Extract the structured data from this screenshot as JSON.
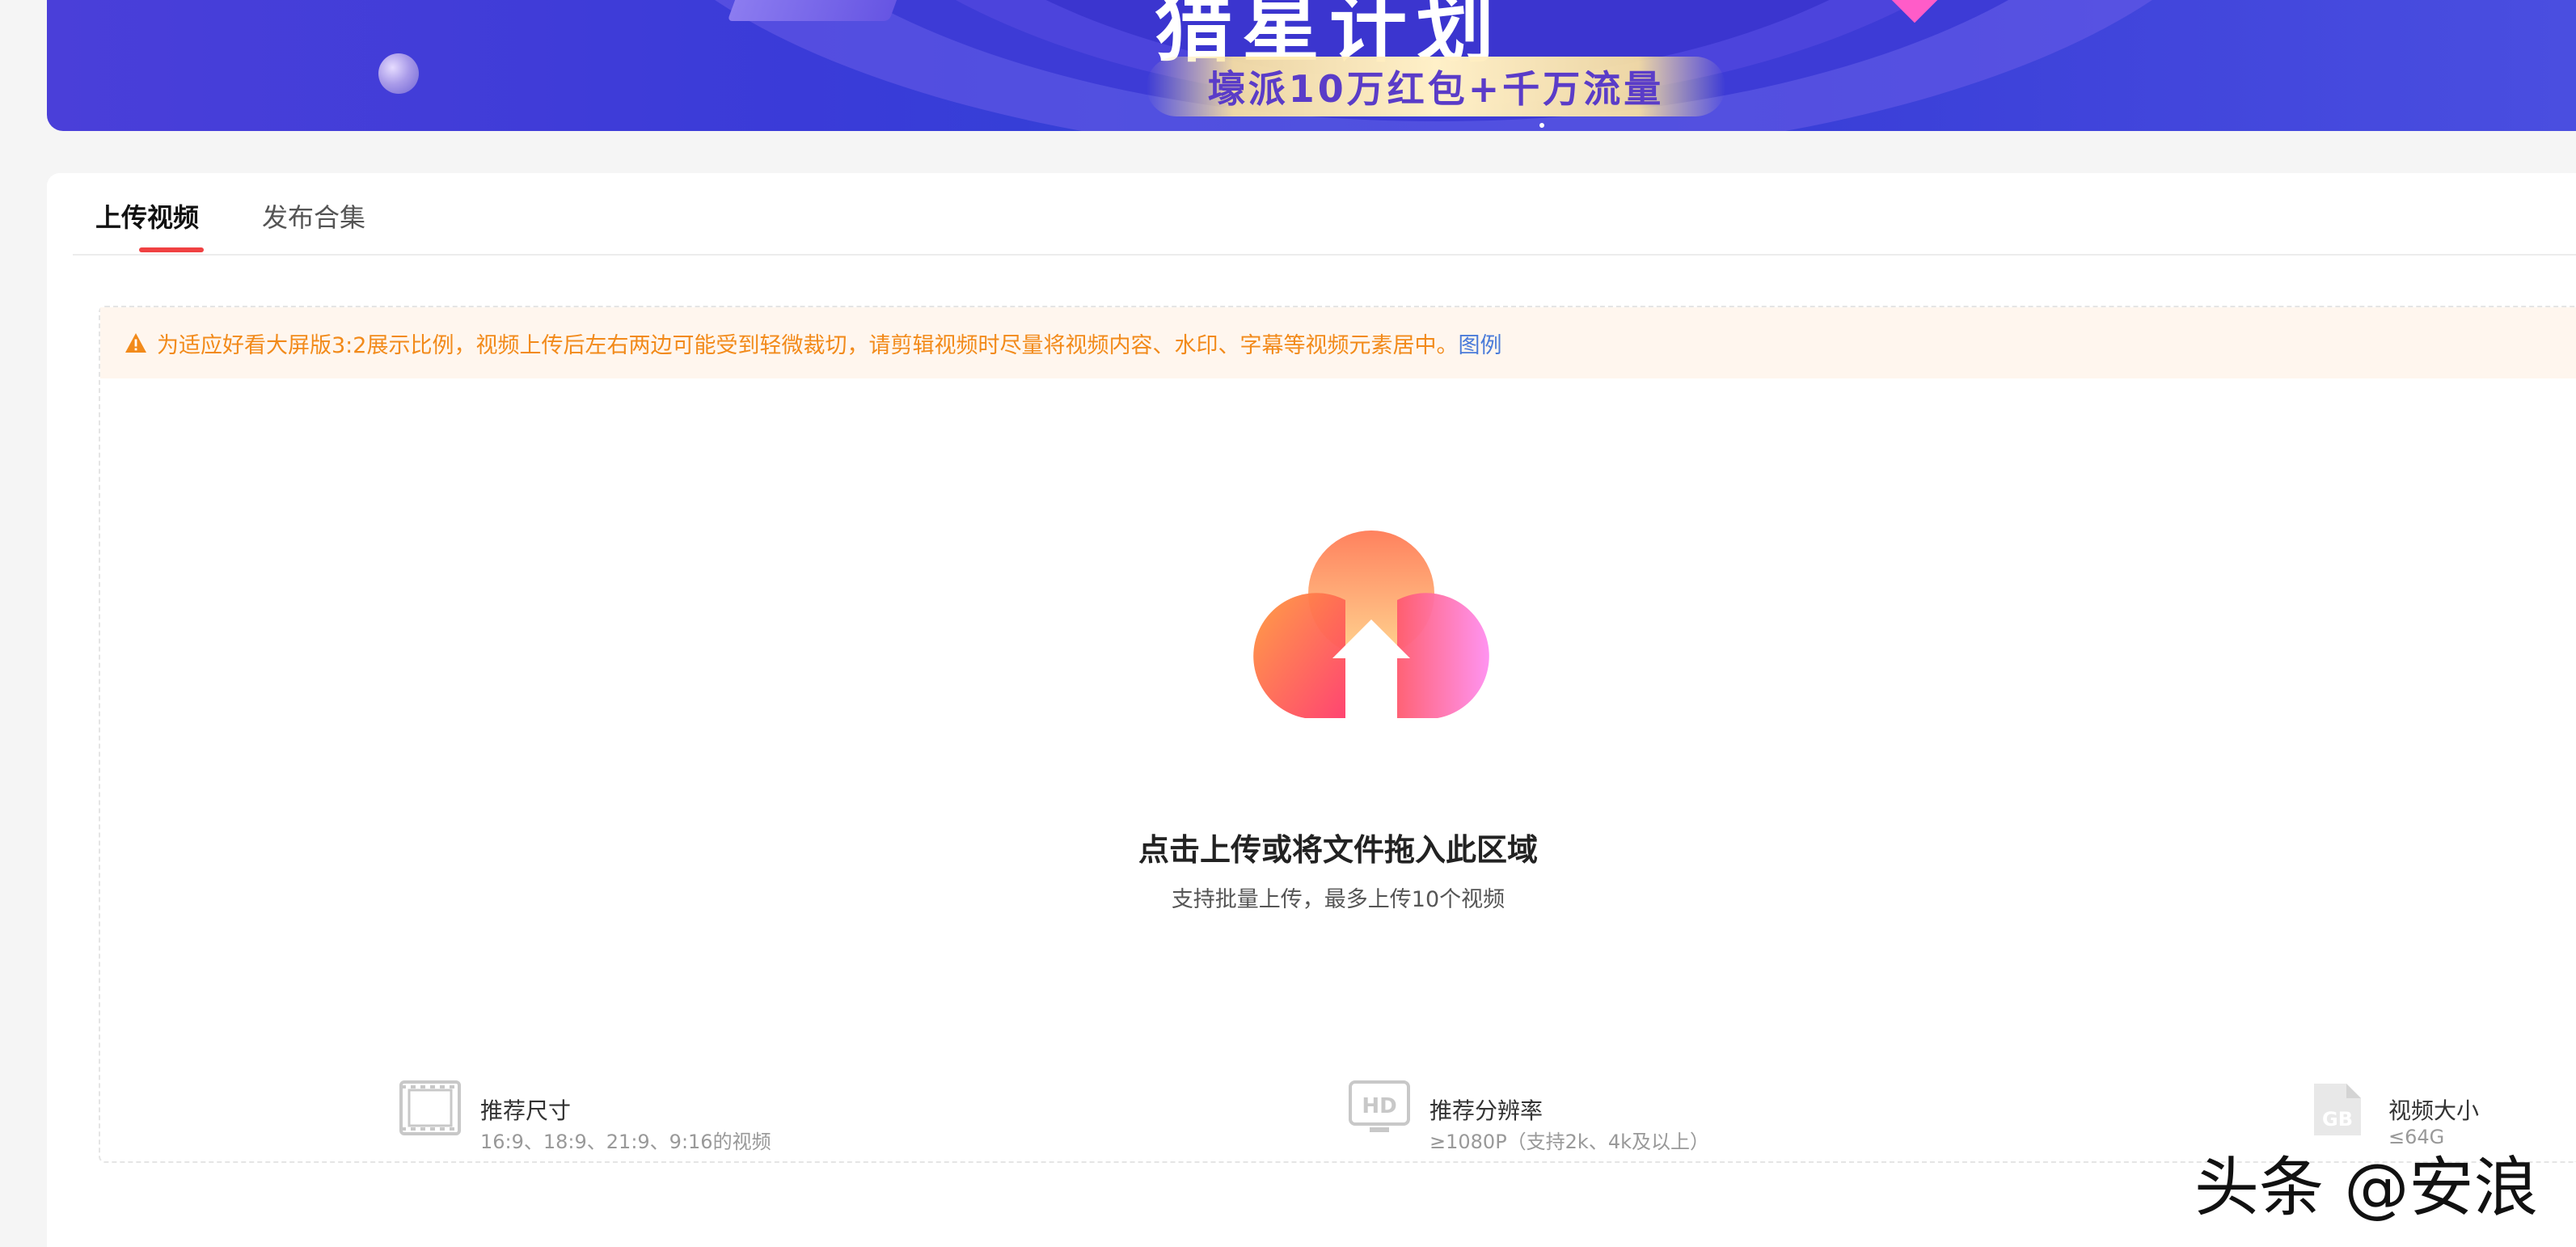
{
  "banner": {
    "title": "猎星计划",
    "subtitle": "壕派10万红包+千万流量"
  },
  "tabs": [
    {
      "label": "上传视频",
      "active": true
    },
    {
      "label": "发布合集",
      "active": false
    }
  ],
  "notice": {
    "text": "为适应好看大屏版3:2展示比例，视频上传后左右两边可能受到轻微裁切，请剪辑视频时尽量将视频内容、水印、字幕等视频元素居中。",
    "link": "图例",
    "icon": "warning-icon",
    "color": "#f28a1a"
  },
  "upload": {
    "title": "点击上传或将文件拖入此区域",
    "subtitle": "支持批量上传，最多上传10个视频",
    "icon": "upload-cloud-icon"
  },
  "specs": [
    {
      "label": "推荐尺寸",
      "value": "16:9、18:9、21:9、9:16的视频",
      "icon": "film-frame-icon"
    },
    {
      "label": "推荐分辨率",
      "value": "≥1080P（支持2k、4k及以上）",
      "icon": "hd-icon"
    },
    {
      "label": "视频大小",
      "value": "≤64G",
      "icon": "gb-file-icon"
    }
  ],
  "watermark": "头条 @安浪",
  "colors": {
    "accent": "#f04142",
    "link": "#4a7bd9",
    "banner": "#3a3bd8"
  }
}
